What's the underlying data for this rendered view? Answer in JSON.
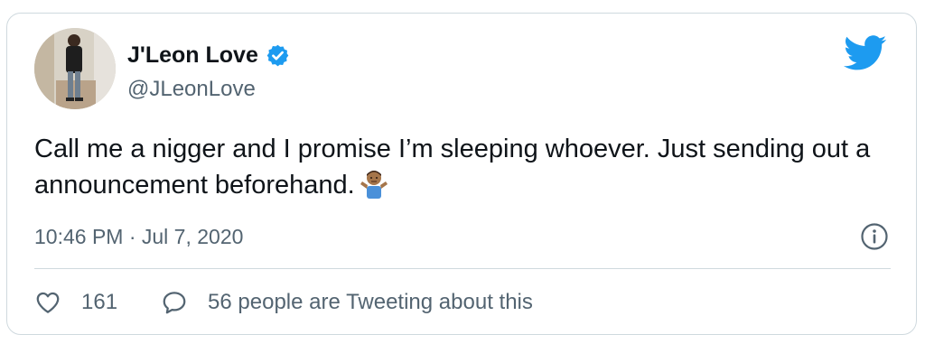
{
  "tweet": {
    "author_name": "J'Leon Love",
    "author_handle": "@JLeonLove",
    "text": "Call me a nigger and I promise I’m sleeping whoever. Just sending out a announcement beforehand.",
    "emoji": "shrugging-man-emoji",
    "timestamp": "10:46 PM · Jul 7, 2020",
    "likes": "161",
    "replies_text": "56 people are Tweeting about this"
  },
  "icons": {
    "verified": "verified-badge-icon",
    "brand": "twitter-bird-icon",
    "info": "info-icon",
    "like": "heart-icon",
    "reply": "speech-bubble-icon"
  },
  "colors": {
    "brand": "#1d9bf0",
    "text": "#0f1419",
    "muted": "#536471",
    "border": "#cfd9de"
  }
}
